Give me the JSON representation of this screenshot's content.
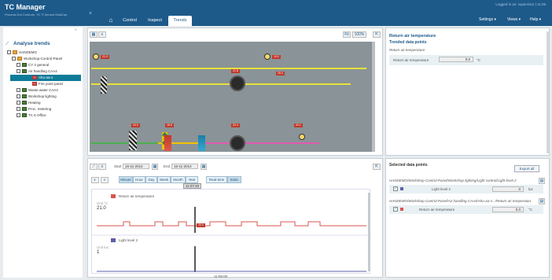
{
  "app": {
    "title": "TC Manager",
    "subtitle": "Process Dot Controls: TC Ti Sensor ModCap",
    "close": "×",
    "user_line": "Logged in as: supervisor  |  11:09"
  },
  "tabs": [
    {
      "label": "Control"
    },
    {
      "label": "Inspect"
    },
    {
      "label": "Trends"
    }
  ],
  "menus": {
    "settings": "Settings ▾",
    "views": "Views ▾",
    "help": "Help ▾"
  },
  "left": {
    "collapse": "«",
    "heading": "Analyse trends",
    "tree": [
      {
        "label": "HANDEMO"
      },
      {
        "label": "Workshop-Control-Panel"
      },
      {
        "label": "CY 2 general"
      },
      {
        "label": "Air handling CAA4"
      },
      {
        "label": "Ahu-aa-s"
      },
      {
        "label": "Fire point panel"
      },
      {
        "label": "Waste water CAA4"
      },
      {
        "label": "Workshop lighting"
      },
      {
        "label": "Heating"
      },
      {
        "label": "Proc. metering"
      },
      {
        "label": "TC 6 Office"
      }
    ]
  },
  "diagram": {
    "fit": "Fit",
    "zoom": "100%",
    "tags": [
      "21.0",
      "19.2",
      "25.3",
      "21.8",
      "24.0",
      "18.6",
      "22.4",
      "20.1"
    ]
  },
  "trend": {
    "start_label": "Start",
    "start": "15-11-2014",
    "end_label": "End",
    "end": "15-11-2014",
    "ranges": [
      "Minute",
      "Hour",
      "Day",
      "Week",
      "Month",
      "Year"
    ],
    "modes": [
      "Real-time",
      "Static"
    ],
    "cursor_time": "11:07:40",
    "bottom_time": "11:08:00",
    "series": [
      {
        "name": "Return air temperature",
        "unit": "Unit °C",
        "value": "21.0",
        "color": "#d9534f",
        "marker": "20.0"
      },
      {
        "name": "Light level 2",
        "unit": "Unit lux",
        "value": "1",
        "color": "#5c5fa8"
      }
    ]
  },
  "right_top": {
    "title": "Return air temperature",
    "subtitle": "Trended data points",
    "note": "Return air temperature",
    "row_label": "Return air temperature",
    "row_value": "0.0",
    "row_unit": "°C"
  },
  "right_bot": {
    "title": "Selected data points",
    "export": "Export all",
    "items": [
      {
        "path": "HANDEMO/Workshop-Control-Panel/Workshop lighting/Light control/Light level 2",
        "label": "Light level 2",
        "value": "0",
        "unit": "lux"
      },
      {
        "path": "HANDEMO/Workshop-Control-Panel/Air handling CAA4/Ahu-aa-s.../Return air temperature",
        "label": "Return air temperature",
        "value": "0.0",
        "unit": "°C"
      }
    ]
  }
}
